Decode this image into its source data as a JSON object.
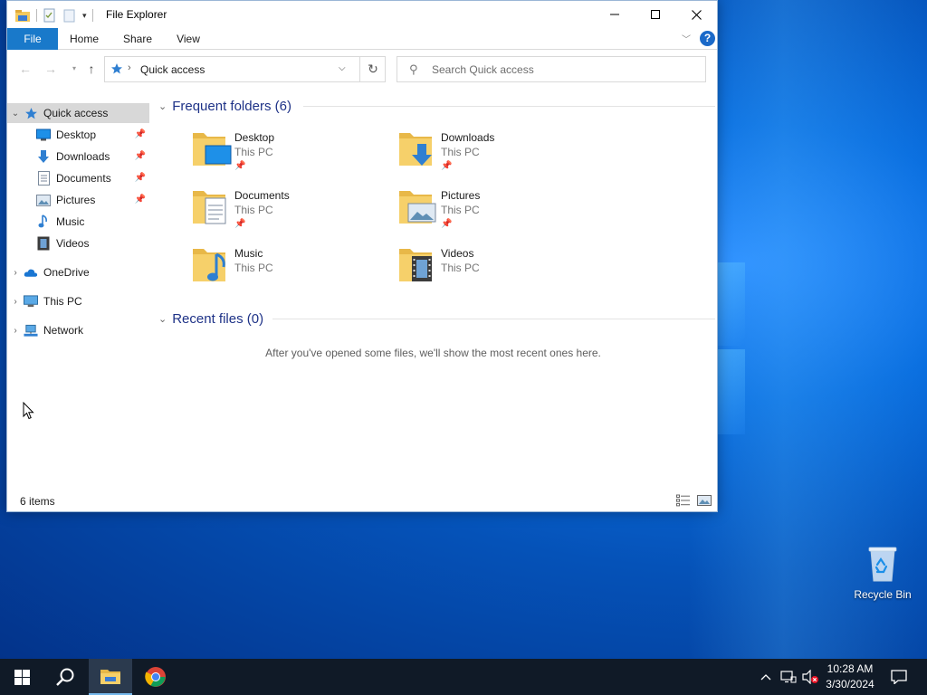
{
  "window": {
    "title": "File Explorer",
    "tabs": [
      {
        "label": "File"
      },
      {
        "label": "Home"
      },
      {
        "label": "Share"
      },
      {
        "label": "View"
      }
    ]
  },
  "address": {
    "crumb": "Quick access"
  },
  "search": {
    "placeholder": "Search Quick access"
  },
  "nav": {
    "quick_access": "Quick access",
    "desktop": "Desktop",
    "downloads": "Downloads",
    "documents": "Documents",
    "pictures": "Pictures",
    "music": "Music",
    "videos": "Videos",
    "onedrive": "OneDrive",
    "this_pc": "This PC",
    "network": "Network"
  },
  "content": {
    "frequent_header": "Frequent folders (6)",
    "recent_header": "Recent files (0)",
    "empty_message": "After you've opened some files, we'll show the most recent ones here.",
    "folders": [
      {
        "name": "Desktop",
        "location": "This PC",
        "pinned": true
      },
      {
        "name": "Downloads",
        "location": "This PC",
        "pinned": true
      },
      {
        "name": "Documents",
        "location": "This PC",
        "pinned": true
      },
      {
        "name": "Pictures",
        "location": "This PC",
        "pinned": true
      },
      {
        "name": "Music",
        "location": "This PC",
        "pinned": false
      },
      {
        "name": "Videos",
        "location": "This PC",
        "pinned": false
      }
    ]
  },
  "status": {
    "items": "6 items"
  },
  "desktop": {
    "recycle_bin": "Recycle Bin"
  },
  "taskbar": {
    "time": "10:28 AM",
    "date": "3/30/2024"
  },
  "colors": {
    "accent": "#1979ca",
    "folder": "#f4c95d",
    "taskbar": "#101a27"
  }
}
